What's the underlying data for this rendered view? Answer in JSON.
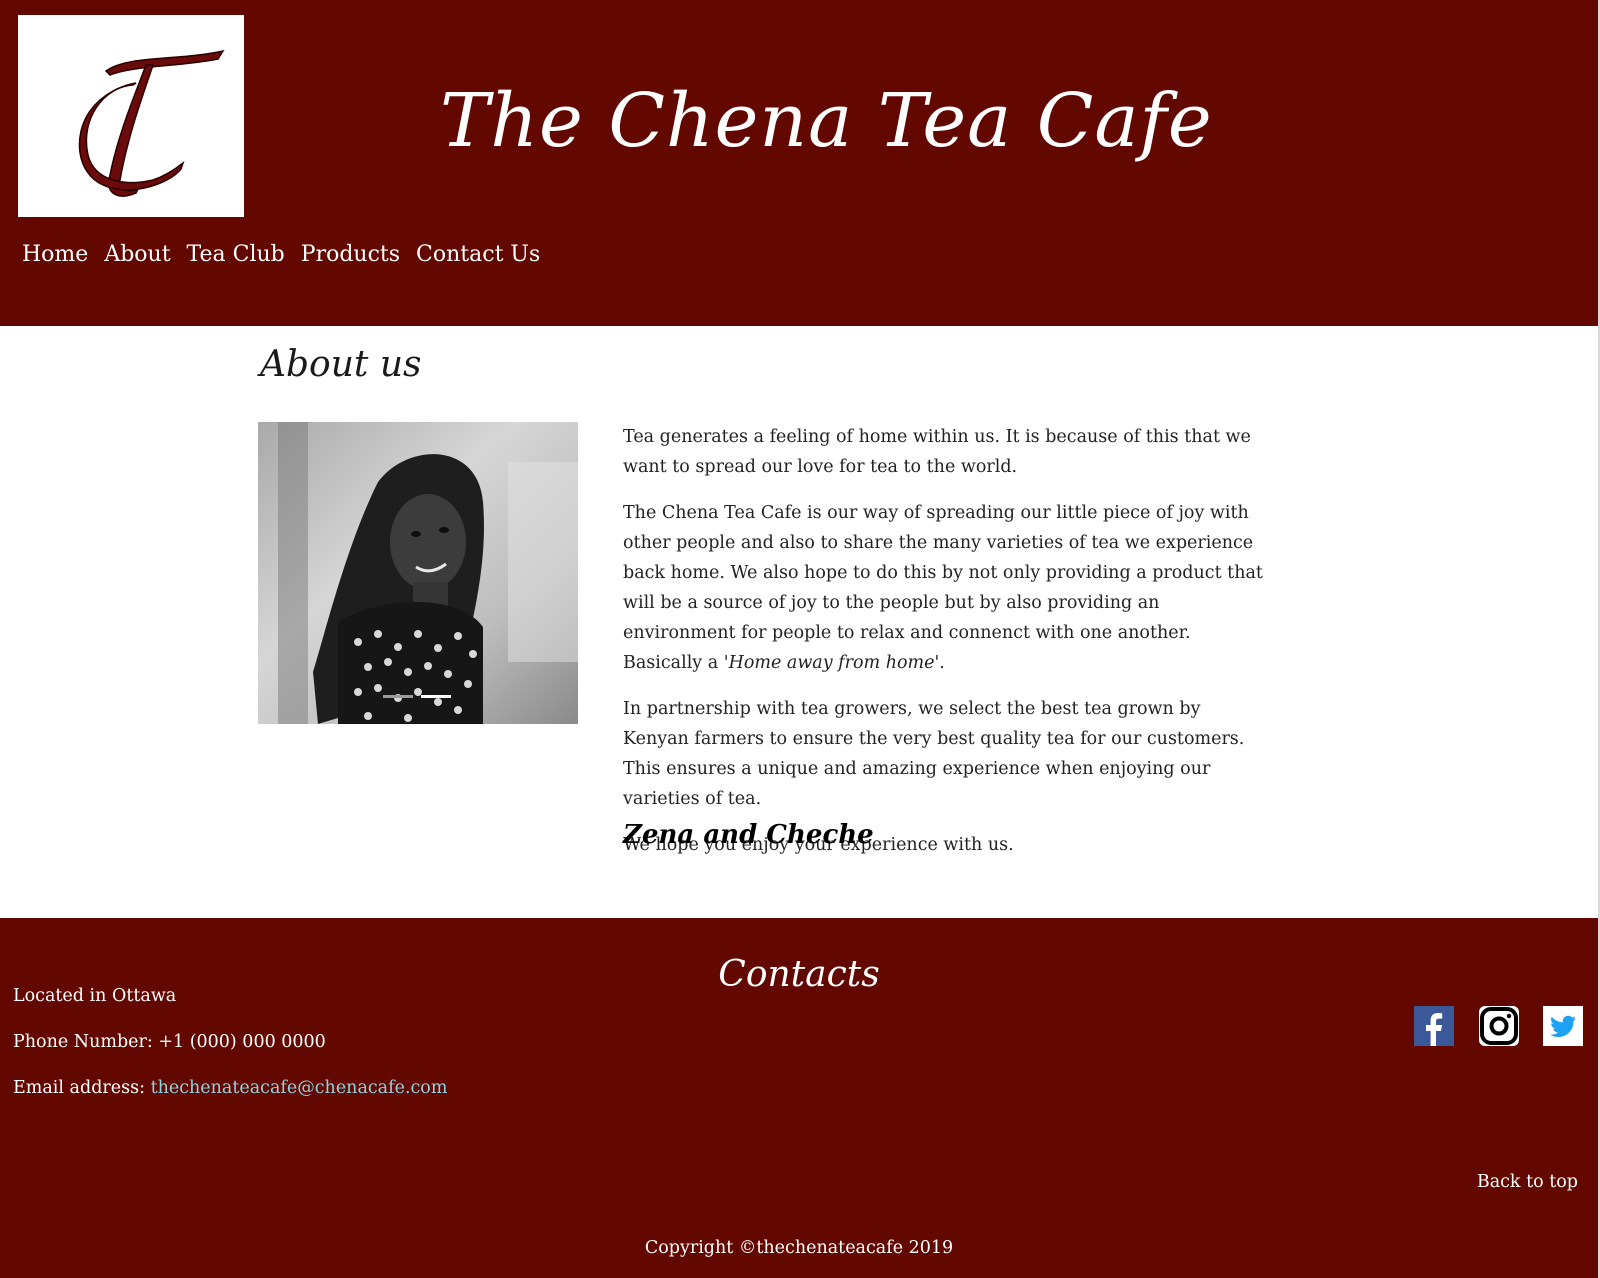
{
  "header": {
    "logo_text": "TC",
    "title": "The Chena Tea Cafe",
    "nav": [
      "Home",
      "About",
      "Tea Club",
      "Products",
      "Contact Us"
    ]
  },
  "main": {
    "heading": "About us",
    "paragraphs": [
      "Tea generates a feeling of home within us. It is because of this that we want to spread our love for tea to the world.",
      "In partnership with tea growers, we select the best tea grown by Kenyan farmers to ensure the very best quality tea for our customers. This ensures a unique and amazing experience when enjoying our varieties of tea.",
      "We hope you enjoy your experience with us."
    ],
    "paragraph2_start": "The Chena Tea Cafe is our way of spreading our little piece of joy with other people and also to share the many varieties of tea we experience back home. We also hope to do this by not only providing a product that will be a source of joy to the people but by also providing an environment for people to relax and connenct with one another. Basically a",
    "paragraph2_quote": "'Home away from home'",
    "paragraph2_end": ".",
    "signature": "Zena and Cheche"
  },
  "footer": {
    "heading": "Contacts",
    "location": "Located in Ottawa",
    "phone": "Phone Number: +1 (000) 000 0000",
    "email_label": "Email address:",
    "email": "thechenateacafe@chenacafe.com",
    "back_to_top": "Back to top",
    "copyright": "Copyright ©thechenateacafe 2019",
    "social": [
      "facebook-icon",
      "instagram-icon",
      "twitter-icon"
    ]
  },
  "colors": {
    "brand": "#630800",
    "link": "#8fd3e0",
    "facebook": "#3b5998",
    "twitter": "#1da1f2"
  }
}
